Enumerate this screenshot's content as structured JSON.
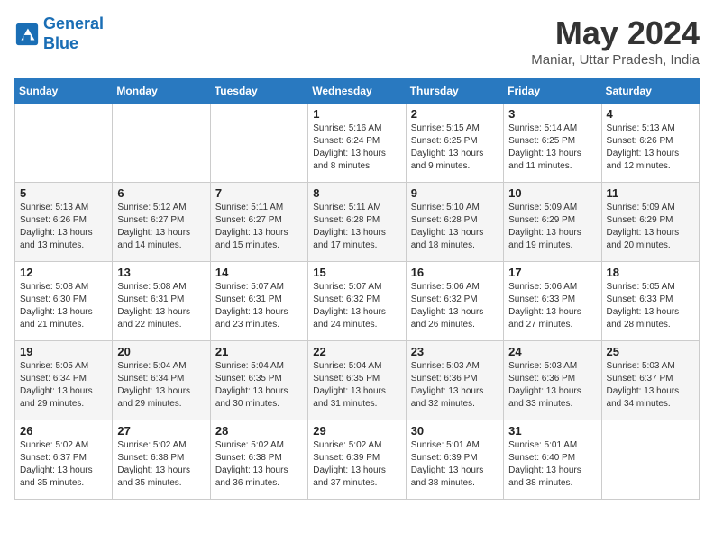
{
  "logo": {
    "line1": "General",
    "line2": "Blue"
  },
  "title": {
    "month": "May 2024",
    "location": "Maniar, Uttar Pradesh, India"
  },
  "weekdays": [
    "Sunday",
    "Monday",
    "Tuesday",
    "Wednesday",
    "Thursday",
    "Friday",
    "Saturday"
  ],
  "weeks": [
    [
      {
        "day": "",
        "info": ""
      },
      {
        "day": "",
        "info": ""
      },
      {
        "day": "",
        "info": ""
      },
      {
        "day": "1",
        "info": "Sunrise: 5:16 AM\nSunset: 6:24 PM\nDaylight: 13 hours\nand 8 minutes."
      },
      {
        "day": "2",
        "info": "Sunrise: 5:15 AM\nSunset: 6:25 PM\nDaylight: 13 hours\nand 9 minutes."
      },
      {
        "day": "3",
        "info": "Sunrise: 5:14 AM\nSunset: 6:25 PM\nDaylight: 13 hours\nand 11 minutes."
      },
      {
        "day": "4",
        "info": "Sunrise: 5:13 AM\nSunset: 6:26 PM\nDaylight: 13 hours\nand 12 minutes."
      }
    ],
    [
      {
        "day": "5",
        "info": "Sunrise: 5:13 AM\nSunset: 6:26 PM\nDaylight: 13 hours\nand 13 minutes."
      },
      {
        "day": "6",
        "info": "Sunrise: 5:12 AM\nSunset: 6:27 PM\nDaylight: 13 hours\nand 14 minutes."
      },
      {
        "day": "7",
        "info": "Sunrise: 5:11 AM\nSunset: 6:27 PM\nDaylight: 13 hours\nand 15 minutes."
      },
      {
        "day": "8",
        "info": "Sunrise: 5:11 AM\nSunset: 6:28 PM\nDaylight: 13 hours\nand 17 minutes."
      },
      {
        "day": "9",
        "info": "Sunrise: 5:10 AM\nSunset: 6:28 PM\nDaylight: 13 hours\nand 18 minutes."
      },
      {
        "day": "10",
        "info": "Sunrise: 5:09 AM\nSunset: 6:29 PM\nDaylight: 13 hours\nand 19 minutes."
      },
      {
        "day": "11",
        "info": "Sunrise: 5:09 AM\nSunset: 6:29 PM\nDaylight: 13 hours\nand 20 minutes."
      }
    ],
    [
      {
        "day": "12",
        "info": "Sunrise: 5:08 AM\nSunset: 6:30 PM\nDaylight: 13 hours\nand 21 minutes."
      },
      {
        "day": "13",
        "info": "Sunrise: 5:08 AM\nSunset: 6:31 PM\nDaylight: 13 hours\nand 22 minutes."
      },
      {
        "day": "14",
        "info": "Sunrise: 5:07 AM\nSunset: 6:31 PM\nDaylight: 13 hours\nand 23 minutes."
      },
      {
        "day": "15",
        "info": "Sunrise: 5:07 AM\nSunset: 6:32 PM\nDaylight: 13 hours\nand 24 minutes."
      },
      {
        "day": "16",
        "info": "Sunrise: 5:06 AM\nSunset: 6:32 PM\nDaylight: 13 hours\nand 26 minutes."
      },
      {
        "day": "17",
        "info": "Sunrise: 5:06 AM\nSunset: 6:33 PM\nDaylight: 13 hours\nand 27 minutes."
      },
      {
        "day": "18",
        "info": "Sunrise: 5:05 AM\nSunset: 6:33 PM\nDaylight: 13 hours\nand 28 minutes."
      }
    ],
    [
      {
        "day": "19",
        "info": "Sunrise: 5:05 AM\nSunset: 6:34 PM\nDaylight: 13 hours\nand 29 minutes."
      },
      {
        "day": "20",
        "info": "Sunrise: 5:04 AM\nSunset: 6:34 PM\nDaylight: 13 hours\nand 29 minutes."
      },
      {
        "day": "21",
        "info": "Sunrise: 5:04 AM\nSunset: 6:35 PM\nDaylight: 13 hours\nand 30 minutes."
      },
      {
        "day": "22",
        "info": "Sunrise: 5:04 AM\nSunset: 6:35 PM\nDaylight: 13 hours\nand 31 minutes."
      },
      {
        "day": "23",
        "info": "Sunrise: 5:03 AM\nSunset: 6:36 PM\nDaylight: 13 hours\nand 32 minutes."
      },
      {
        "day": "24",
        "info": "Sunrise: 5:03 AM\nSunset: 6:36 PM\nDaylight: 13 hours\nand 33 minutes."
      },
      {
        "day": "25",
        "info": "Sunrise: 5:03 AM\nSunset: 6:37 PM\nDaylight: 13 hours\nand 34 minutes."
      }
    ],
    [
      {
        "day": "26",
        "info": "Sunrise: 5:02 AM\nSunset: 6:37 PM\nDaylight: 13 hours\nand 35 minutes."
      },
      {
        "day": "27",
        "info": "Sunrise: 5:02 AM\nSunset: 6:38 PM\nDaylight: 13 hours\nand 35 minutes."
      },
      {
        "day": "28",
        "info": "Sunrise: 5:02 AM\nSunset: 6:38 PM\nDaylight: 13 hours\nand 36 minutes."
      },
      {
        "day": "29",
        "info": "Sunrise: 5:02 AM\nSunset: 6:39 PM\nDaylight: 13 hours\nand 37 minutes."
      },
      {
        "day": "30",
        "info": "Sunrise: 5:01 AM\nSunset: 6:39 PM\nDaylight: 13 hours\nand 38 minutes."
      },
      {
        "day": "31",
        "info": "Sunrise: 5:01 AM\nSunset: 6:40 PM\nDaylight: 13 hours\nand 38 minutes."
      },
      {
        "day": "",
        "info": ""
      }
    ]
  ]
}
